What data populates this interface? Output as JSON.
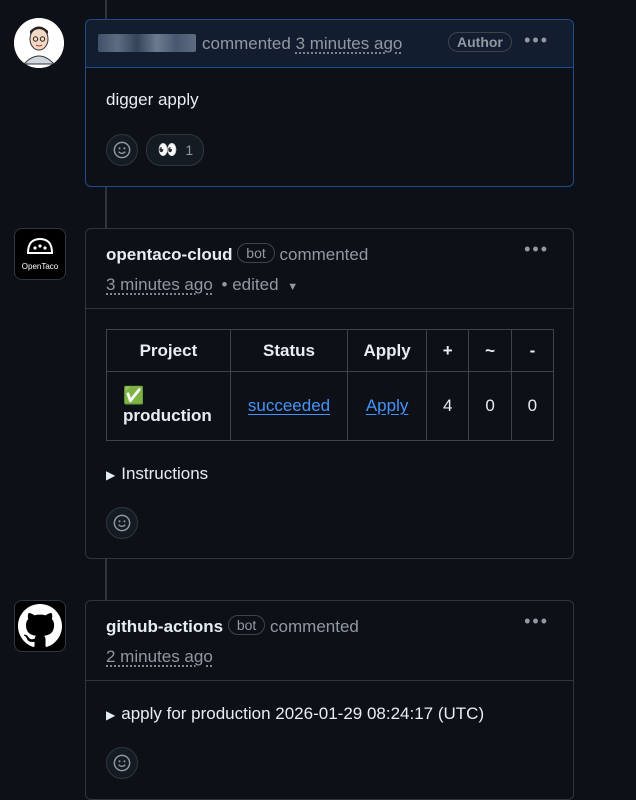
{
  "comments": [
    {
      "author": "",
      "action": "commented",
      "time": "3 minutes ago",
      "badge": "Author",
      "body": "digger apply",
      "reaction": {
        "emoji": "👀",
        "count": "1"
      }
    },
    {
      "author": "opentaco-cloud",
      "badge": "bot",
      "action": "commented",
      "time": "3 minutes ago",
      "edited": "• edited",
      "avatar_text": "OpenTaco",
      "table": {
        "headers": [
          "Project",
          "Status",
          "Apply",
          "+",
          "~",
          "-"
        ],
        "row": {
          "project_emoji": "✅",
          "project": "production",
          "status": "succeeded",
          "apply": "Apply",
          "add": "4",
          "change": "0",
          "destroy": "0"
        }
      },
      "details": "Instructions"
    },
    {
      "author": "github-actions",
      "badge": "bot",
      "action": "commented",
      "time": "2 minutes ago",
      "details": "apply for production 2026-01-29 08:24:17 (UTC)"
    }
  ],
  "colors": {
    "background": "#0d1117",
    "border": "#30363d",
    "link": "#4493f8",
    "author_border": "#1f4d87"
  },
  "icons": {
    "kebab": "kebab-horizontal-icon",
    "smiley": "smiley-icon",
    "disclosure": "triangle-right-icon",
    "github": "github-mark-icon"
  }
}
